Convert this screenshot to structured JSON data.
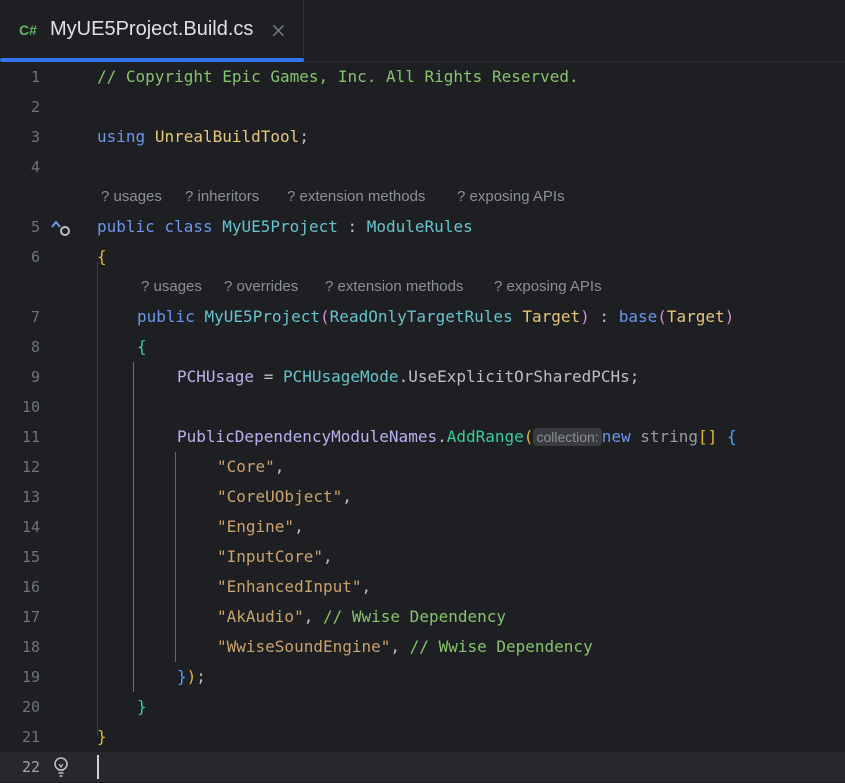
{
  "tab": {
    "lang_badge": "C#",
    "title": "MyUE5Project.Build.cs",
    "close_glyph": "×"
  },
  "hints": {
    "class": [
      "? usages",
      "? inheritors",
      "? extension methods",
      "? exposing APIs"
    ],
    "ctor": [
      "? usages",
      "? overrides",
      "? extension methods",
      "? exposing APIs"
    ]
  },
  "editor": {
    "line_numbers": [
      "1",
      "2",
      "3",
      "4",
      "5",
      "6",
      "7",
      "8",
      "9",
      "10",
      "11",
      "12",
      "13",
      "14",
      "15",
      "16",
      "17",
      "18",
      "19",
      "20",
      "21",
      "22"
    ],
    "code": {
      "l1_comment": "// Copyright Epic Games, Inc. All Rights Reserved.",
      "l3_using": "using",
      "l3_ns": "UnrealBuildTool",
      "l3_semi": ";",
      "l5_public": "public",
      "l5_class": "class",
      "l5_name": "MyUE5Project",
      "l5_colon": " : ",
      "l5_base": "ModuleRules",
      "l6_open": "{",
      "l7_public": "public",
      "l7_name": "MyUE5Project",
      "l7_paren_open": "(",
      "l7_type": "ReadOnlyTargetRules",
      "l7_param": "Target",
      "l7_paren_close": ")",
      "l7_colon": " : ",
      "l7_base": "base",
      "l7_bparen_open": "(",
      "l7_barg": "Target",
      "l7_bparen_close": ")",
      "l8_open": "{",
      "l9_lhs": "PCHUsage",
      "l9_eq": " = ",
      "l9_type": "PCHUsageMode",
      "l9_rest": ".UseExplicitOrSharedPCHs;",
      "l11_obj": "PublicDependencyModuleNames",
      "l11_dot": ".",
      "l11_method": "AddRange",
      "l11_paren": "(",
      "l11_param_hint": "collection:",
      "l11_new": "new",
      "l11_string": "string",
      "l11_arr": "[]",
      "l11_brace": "{",
      "l12_str": "\"Core\"",
      "l13_str": "\"CoreUObject\"",
      "l14_str": "\"Engine\"",
      "l15_str": "\"InputCore\"",
      "l16_str": "\"EnhancedInput\"",
      "l17_str": "\"AkAudio\"",
      "l17_cmt": "// Wwise Dependency",
      "l18_str": "\"WwiseSoundEngine\"",
      "l18_cmt": "// Wwise Dependency",
      "comma": ",",
      "l19_close_brace": "}",
      "l19_close_paren": ")",
      "l19_semi": ";",
      "l20_close": "}",
      "l21_close": "}"
    }
  },
  "colors": {
    "background": "#1e1f22",
    "keyword": "#6c95eb",
    "type": "#66c3cc",
    "method": "#39cc9b",
    "string": "#c9a26d",
    "comment": "#85c46c",
    "accent": "#3574f0"
  },
  "icons": {
    "override_gutter": "implemented-override-icon",
    "intention_gutter": "lightbulb-icon"
  }
}
